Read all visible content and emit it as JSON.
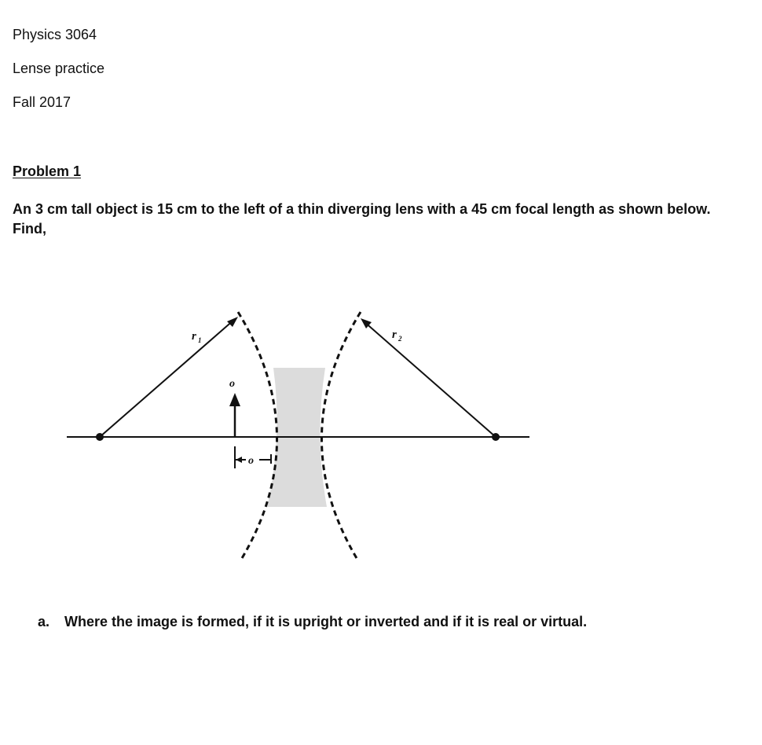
{
  "header": {
    "course": "Physics 3064",
    "topic": "Lense practice",
    "term": "Fall 2017"
  },
  "problem": {
    "title": "Problem 1",
    "statement": "An 3 cm tall object is 15 cm to the left of a thin diverging lens with a 45 cm focal length as shown below. Find,",
    "given": {
      "object_height_cm": 3,
      "object_distance_cm": 15,
      "lens_type": "diverging",
      "focal_length_cm": 45
    }
  },
  "diagram": {
    "labels": {
      "r1": "r",
      "r1_sub": "1",
      "r2": "r",
      "r2_sub": "2",
      "object": "o",
      "object_distance": "o"
    },
    "colors": {
      "ink": "#111111",
      "lens_fill": "#d9d9d9"
    }
  },
  "questions": [
    {
      "label": "a.",
      "text": "Where the image is formed, if it is upright or inverted and if it is real or virtual."
    }
  ]
}
